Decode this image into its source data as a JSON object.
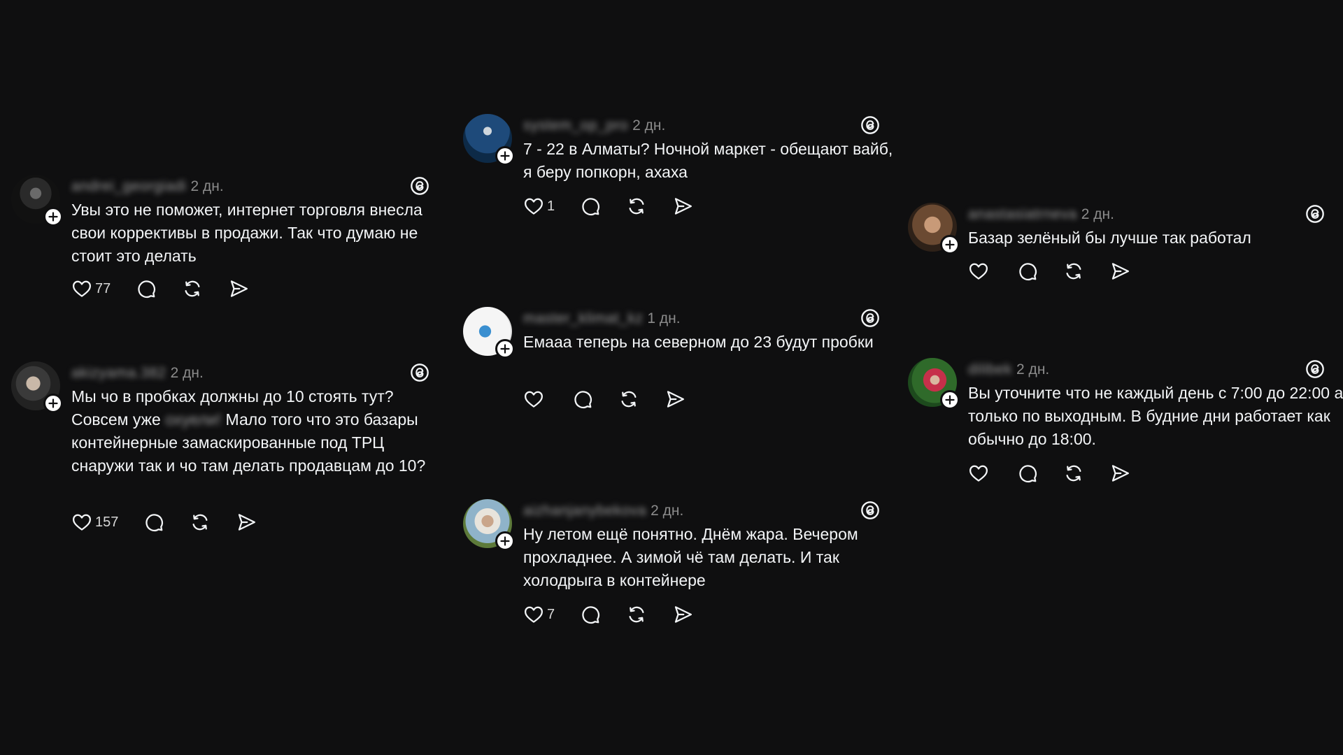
{
  "posts": [
    {
      "username": "andrei_georgiadi",
      "time": "2 дн.",
      "text": "Увы это не поможет, интернет торговля внесла свои коррективы в продажи. Так что думаю не стоит это делать",
      "likes": "77"
    },
    {
      "username": "akizyama.382",
      "time": "2 дн.",
      "text_parts": [
        "Мы чо в пробках должны до 10 стоять тут? Совсем уже ",
        "охуели!",
        " Мало того что это базары контейнерные замаскированные под ТРЦ снаружи так и чо там делать продавцам до 10?"
      ],
      "likes": "157"
    },
    {
      "username": "system_op_pro",
      "time": "2 дн.",
      "text": "7 - 22 в Алматы? Ночной маркет - обещают вайб, я беру попкорн, ахаха",
      "likes": "1"
    },
    {
      "username": "master_klimat_kz",
      "time": "1 дн.",
      "text": "Емааа теперь на северном до 23 будут пробки",
      "likes": ""
    },
    {
      "username": "aizhanjanybekova",
      "time": "2 дн.",
      "text": "Ну летом ещё понятно. Днём жара. Вечером прохладнее. А зимой чё там делать. И так холодрыга в контейнере",
      "likes": "7"
    },
    {
      "username": "anastasiatrneva",
      "time": "2 дн.",
      "text": "Базар зелёный бы лучше так работал",
      "likes": ""
    },
    {
      "username": "dilibek",
      "time": "2 дн.",
      "text": "Вы уточните что не каждый день с 7:00 до 22:00 а только по выходным. В будние дни работает как обычно до 18:00.",
      "likes": ""
    }
  ],
  "colors": {
    "background": "#0f0f10",
    "text": "#f3f5f7",
    "muted": "#8b8b8b"
  },
  "icons": [
    "threads-logo-icon",
    "heart-icon",
    "comment-icon",
    "repost-icon",
    "share-icon",
    "plus-icon"
  ]
}
